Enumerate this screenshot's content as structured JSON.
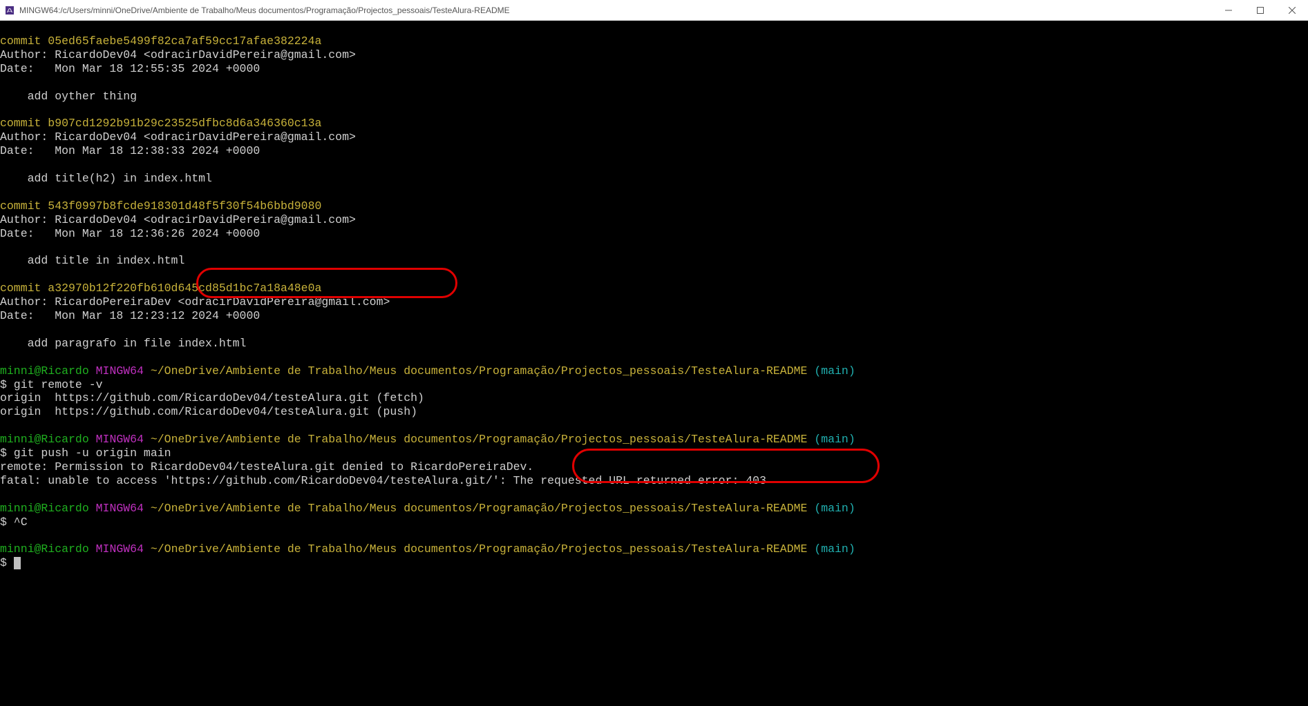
{
  "window": {
    "title": "MINGW64:/c/Users/minni/OneDrive/Ambiente de Trabalho/Meus documentos/Programação/Projectos_pessoais/TesteAlura-README"
  },
  "commits": [
    {
      "hash": "commit 05ed65faebe5499f82ca7af59cc17afae382224a",
      "author": "Author: RicardoDev04 <odracirDavidPereira@gmail.com>",
      "date": "Date:   Mon Mar 18 12:55:35 2024 +0000",
      "msg": "    add oyther thing"
    },
    {
      "hash": "commit b907cd1292b91b29c23525dfbc8d6a346360c13a",
      "author": "Author: RicardoDev04 <odracirDavidPereira@gmail.com>",
      "date": "Date:   Mon Mar 18 12:38:33 2024 +0000",
      "msg": "    add title(h2) in index.html"
    },
    {
      "hash": "commit 543f0997b8fcde918301d48f5f30f54b6bbd9080",
      "author": "Author: RicardoDev04 <odracirDavidPereira@gmail.com>",
      "date": "Date:   Mon Mar 18 12:36:26 2024 +0000",
      "msg": "    add title in index.html"
    },
    {
      "hash": "commit a32970b12f220fb610d645cd85d1bc7a18a48e0a",
      "author": "Author: RicardoPereiraDev <odracirDavidPereira@gmail.com>",
      "date": "Date:   Mon Mar 18 12:23:12 2024 +0000",
      "msg": "    add paragrafo in file index.html"
    }
  ],
  "prompt": {
    "user_host": "minni@Ricardo",
    "shell": "MINGW64",
    "path": "~/OneDrive/Ambiente de Trabalho/Meus documentos/Programação/Projectos_pessoais/TesteAlura-README",
    "branch": "(main)"
  },
  "session": {
    "cmd1": "$ git remote -v",
    "remote_fetch": "origin  https://github.com/RicardoDev04/testeAlura.git (fetch)",
    "remote_push": "origin  https://github.com/RicardoDev04/testeAlura.git (push)",
    "cmd2": "$ git push -u origin main",
    "err1": "remote: Permission to RicardoDev04/testeAlura.git denied to RicardoPereiraDev.",
    "err2": "fatal: unable to access 'https://github.com/RicardoDev04/testeAlura.git/': The requested URL returned error: 403",
    "cmd3": "$ ^C",
    "cmd4": "$ "
  },
  "annotation_colors": {
    "stroke": "#e00000"
  }
}
